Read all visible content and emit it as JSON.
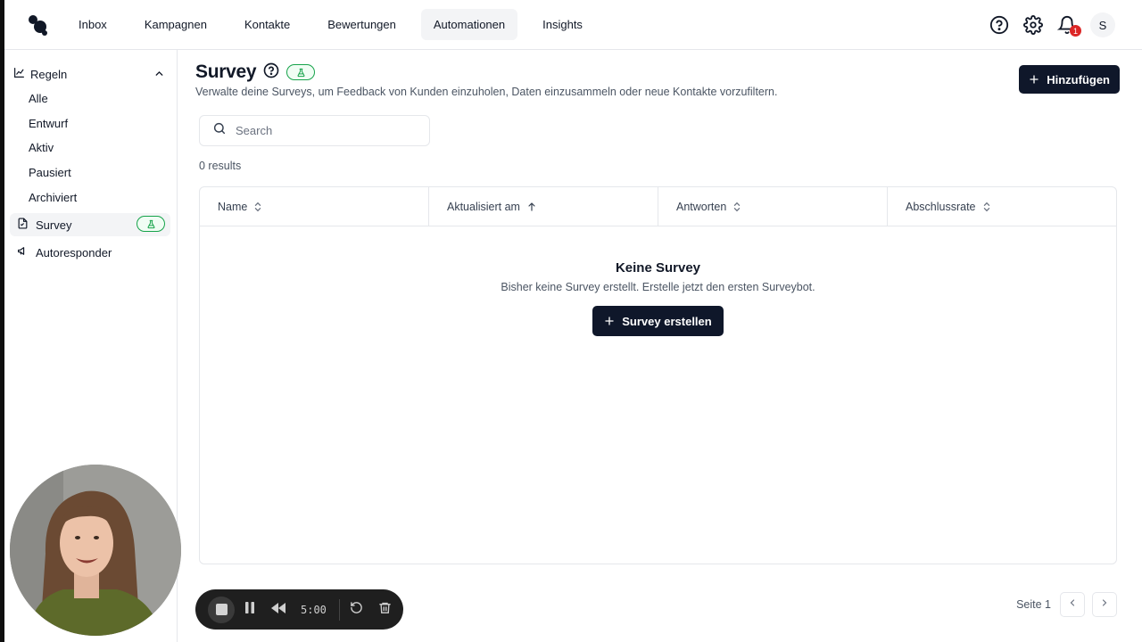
{
  "nav": {
    "items": [
      {
        "label": "Inbox",
        "active": false
      },
      {
        "label": "Kampagnen",
        "active": false
      },
      {
        "label": "Kontakte",
        "active": false
      },
      {
        "label": "Bewertungen",
        "active": false
      },
      {
        "label": "Automationen",
        "active": true
      },
      {
        "label": "Insights",
        "active": false
      }
    ],
    "notification_count": "1",
    "avatar_initial": "S"
  },
  "sidebar": {
    "group_label": "Regeln",
    "sub_items": [
      "Alle",
      "Entwurf",
      "Aktiv",
      "Pausiert",
      "Archiviert"
    ],
    "items": [
      {
        "label": "Survey",
        "active": true,
        "icon": "document-icon"
      },
      {
        "label": "Autoresponder",
        "active": false,
        "icon": "megaphone-icon"
      }
    ]
  },
  "main": {
    "title": "Survey",
    "subtitle": "Verwalte deine Surveys, um Feedback von Kunden einzuholen, Daten einzusammeln oder neue Kontakte vorzufiltern.",
    "add_button": "Hinzufügen",
    "search_placeholder": "Search",
    "results": "0 results",
    "columns": [
      "Name",
      "Aktualisiert am",
      "Antworten",
      "Abschlussrate"
    ],
    "empty_title": "Keine Survey",
    "empty_desc": "Bisher keine Survey erstellt. Erstelle jetzt den ersten Surveybot.",
    "create_button": "Survey erstellen",
    "page_label": "Seite 1"
  },
  "recorder": {
    "time": "5:00"
  },
  "colors": {
    "primary_button": "#0f172a",
    "beta_green": "#16a34a",
    "badge_red": "#dc2626"
  }
}
